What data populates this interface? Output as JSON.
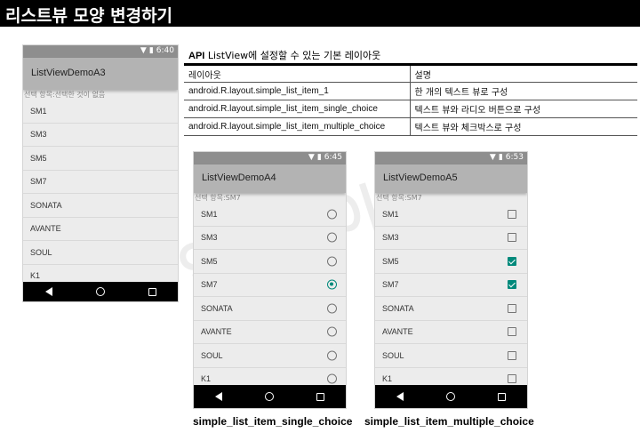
{
  "slide": {
    "title": "리스트뷰 모양 변경하기"
  },
  "api_heading": {
    "prefix": "API",
    "text": " ListView에 설정할 수 있는 기본 레이아웃"
  },
  "table": {
    "headers": [
      "레이아웃",
      "설명"
    ],
    "rows": [
      [
        "android.R.layout.simple_list_item_1",
        "한 개의 텍스트 뷰로 구성"
      ],
      [
        "android.R.layout.simple_list_item_single_choice",
        "텍스트 뷰와 라디오 버튼으로 구성"
      ],
      [
        "android.R.layout.simple_list_item_multiple_choice",
        "텍스트 뷰와 체크박스로 구성"
      ]
    ]
  },
  "phones": [
    {
      "time": "6:40",
      "app_title": "ListViewDemoA3",
      "selected_text": "선택 항목:선택한 것이 없음",
      "items": [
        "SM1",
        "SM3",
        "SM5",
        "SM7",
        "SONATA",
        "AVANTE",
        "SOUL",
        "K1"
      ],
      "control": "none"
    },
    {
      "time": "6:45",
      "app_title": "ListViewDemoA4",
      "selected_text": "선택 항목:SM7",
      "items": [
        "SM1",
        "SM3",
        "SM5",
        "SM7",
        "SONATA",
        "AVANTE",
        "SOUL",
        "K1"
      ],
      "control": "radio",
      "checked": [
        false,
        false,
        false,
        true,
        false,
        false,
        false,
        false
      ]
    },
    {
      "time": "6:53",
      "app_title": "ListViewDemoA5",
      "selected_text": "선택 항목:SM7",
      "items": [
        "SM1",
        "SM3",
        "SM5",
        "SM7",
        "SONATA",
        "AVANTE",
        "SOUL",
        "K1"
      ],
      "control": "checkbox",
      "checked": [
        false,
        false,
        true,
        true,
        false,
        false,
        false,
        false
      ]
    }
  ],
  "captions": [
    "simple_list_item_single_choice",
    "simple_list_item_multiple_choice"
  ],
  "colors": {
    "accent": "#00897b",
    "appbar": "#b3b3b3",
    "statusbar": "#8e8e8e",
    "navbar": "#000000"
  },
  "icons": {
    "wifi": "wifi-icon",
    "battery": "battery-icon",
    "back": "back-icon",
    "home": "home-icon",
    "recents": "recents-icon"
  }
}
